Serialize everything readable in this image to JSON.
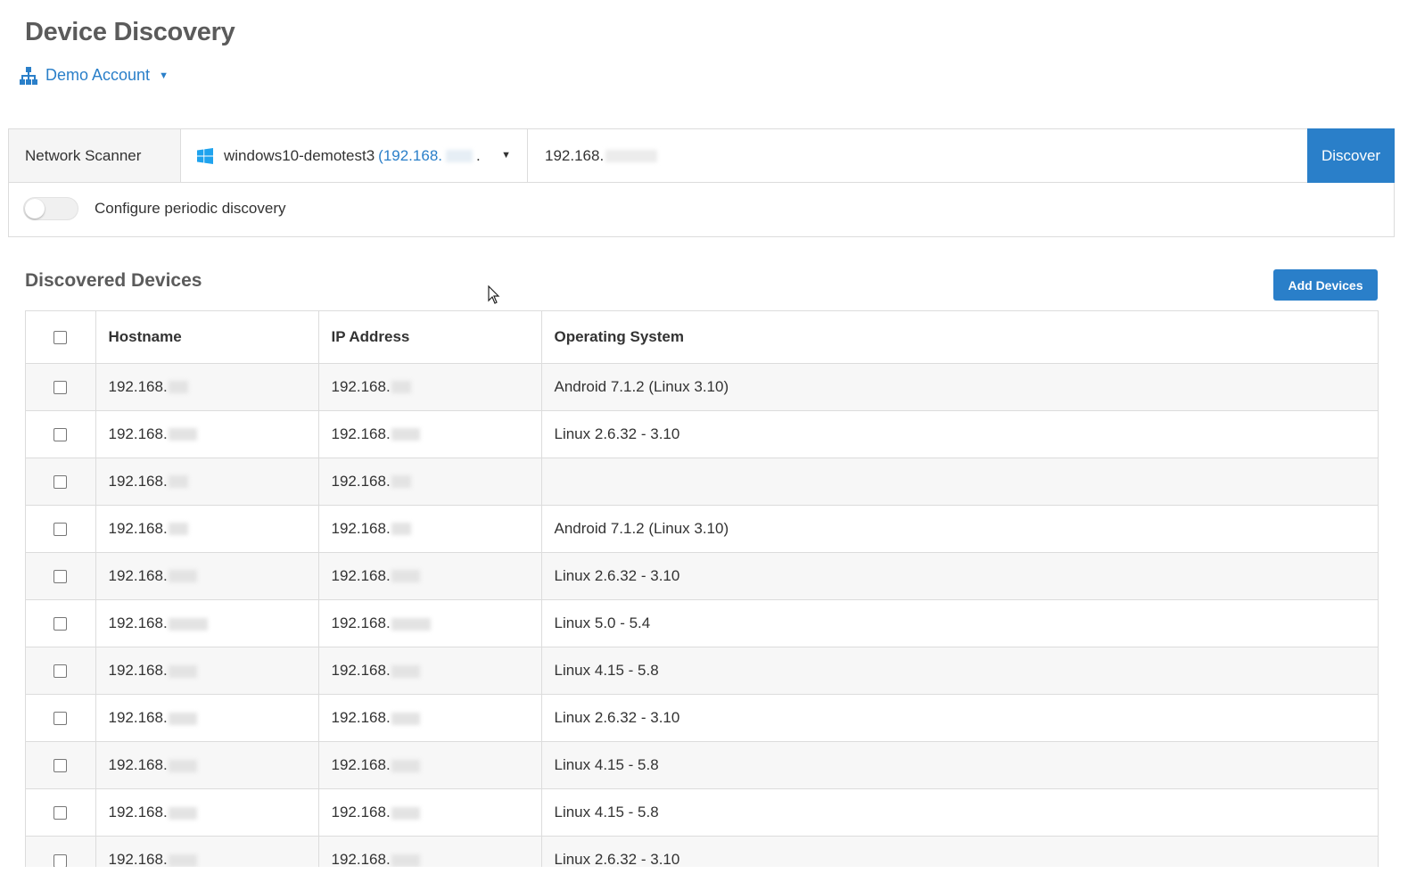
{
  "header": {
    "title": "Device Discovery",
    "account_label": "Demo Account"
  },
  "scanner": {
    "label": "Network Scanner",
    "agent_name": "windows10-demotest3",
    "agent_ip": "(192.168.",
    "agent_ip_tail": ".",
    "range_value": "192.168.",
    "discover_label": "Discover",
    "periodic_label": "Configure periodic discovery",
    "periodic_enabled": false
  },
  "discovered": {
    "title": "Discovered Devices",
    "add_label": "Add Devices",
    "columns": [
      "Hostname",
      "IP Address",
      "Operating System"
    ],
    "rows": [
      {
        "hostname": "192.168.",
        "ip": "192.168.",
        "os": "Android 7.1.2 (Linux 3.10)"
      },
      {
        "hostname": "192.168.",
        "ip": "192.168.",
        "os": "Linux 2.6.32 - 3.10"
      },
      {
        "hostname": "192.168.",
        "ip": "192.168.",
        "os": ""
      },
      {
        "hostname": "192.168.",
        "ip": "192.168.",
        "os": "Android 7.1.2 (Linux 3.10)"
      },
      {
        "hostname": "192.168.",
        "ip": "192.168.",
        "os": "Linux 2.6.32 - 3.10"
      },
      {
        "hostname": "192.168.",
        "ip": "192.168.",
        "os": "Linux 5.0 - 5.4"
      },
      {
        "hostname": "192.168.",
        "ip": "192.168.",
        "os": "Linux 4.15 - 5.8"
      },
      {
        "hostname": "192.168.",
        "ip": "192.168.",
        "os": "Linux 2.6.32 - 3.10"
      },
      {
        "hostname": "192.168.",
        "ip": "192.168.",
        "os": "Linux 4.15 - 5.8"
      },
      {
        "hostname": "192.168.",
        "ip": "192.168.",
        "os": "Linux 4.15 - 5.8"
      },
      {
        "hostname": "192.168.",
        "ip": "192.168.",
        "os": "Linux 2.6.32 - 3.10"
      }
    ]
  },
  "colors": {
    "accent": "#2a7fc9",
    "windows_icon": "#1fa3ee"
  }
}
